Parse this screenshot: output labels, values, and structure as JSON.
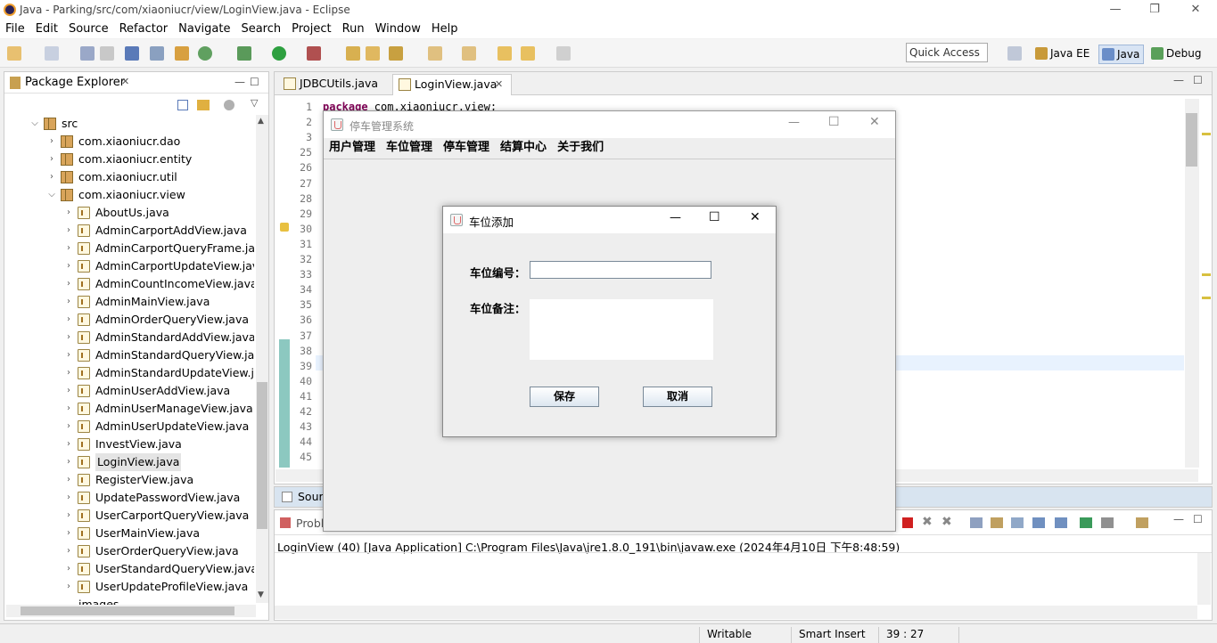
{
  "window": {
    "title": "Java - Parking/src/com/xiaoniucr/view/LoginView.java - Eclipse",
    "minimize": "—",
    "restore": "❐",
    "close": "✕"
  },
  "menubar": [
    "File",
    "Edit",
    "Source",
    "Refactor",
    "Navigate",
    "Search",
    "Project",
    "Run",
    "Window",
    "Help"
  ],
  "toolbar": {
    "quick_access": "Quick Access",
    "perspectives": [
      {
        "label": "Java EE",
        "color": "#c89a3a"
      },
      {
        "label": "Java",
        "color": "#6a8ec8"
      },
      {
        "label": "Debug",
        "color": "#5aa05a"
      }
    ]
  },
  "package_explorer": {
    "title": "Package Explorer",
    "close": "✕",
    "src": "src",
    "packages": [
      "com.xiaoniucr.dao",
      "com.xiaoniucr.entity",
      "com.xiaoniucr.util",
      "com.xiaoniucr.view"
    ],
    "files": [
      "AboutUs.java",
      "AdminCarportAddView.java",
      "AdminCarportQueryFrame.java",
      "AdminCarportUpdateView.java",
      "AdminCountIncomeView.java",
      "AdminMainView.java",
      "AdminOrderQueryView.java",
      "AdminStandardAddView.java",
      "AdminStandardQueryView.java",
      "AdminStandardUpdateView.jav",
      "AdminUserAddView.java",
      "AdminUserManageView.java",
      "AdminUserUpdateView.java",
      "InvestView.java",
      "LoginView.java",
      "RegisterView.java",
      "UpdatePasswordView.java",
      "UserCarportQueryView.java",
      "UserMainView.java",
      "UserOrderQueryView.java",
      "UserStandardQueryView.java",
      "UserUpdateProfileView.java"
    ],
    "partial_last": "images"
  },
  "editor": {
    "tabs": [
      {
        "label": "JDBCUtils.java"
      },
      {
        "label": "LoginView.java",
        "close": "✕"
      }
    ],
    "line_numbers": [
      "1",
      "2",
      "3",
      "25",
      "26",
      "27",
      "28",
      "29",
      "30",
      "31",
      "32",
      "33",
      "34",
      "35",
      "36",
      "37",
      "38",
      "39",
      "40",
      "41",
      "42",
      "43",
      "44",
      "45"
    ],
    "code_keyword": "package",
    "code_text": " com.xiaoniucr.view;"
  },
  "source_tab": "Sour",
  "console": {
    "tab_partial": "Probl",
    "launch": "LoginView (40) [Java Application] C:\\Program Files\\Java\\jre1.8.0_191\\bin\\javaw.exe (2024年4月10日 下午8:48:59)"
  },
  "statusbar": {
    "writable": "Writable",
    "insert_mode": "Smart Insert",
    "position": "39 : 27"
  },
  "swing_main": {
    "title": "停车管理系统",
    "menus": [
      "用户管理",
      "车位管理",
      "停车管理",
      "结算中心",
      "关于我们"
    ]
  },
  "dialog": {
    "title": "车位添加",
    "number_label": "车位编号：",
    "number_value": "",
    "remark_label": "车位备注：",
    "remark_value": "",
    "save": "保存",
    "cancel": "取消"
  }
}
